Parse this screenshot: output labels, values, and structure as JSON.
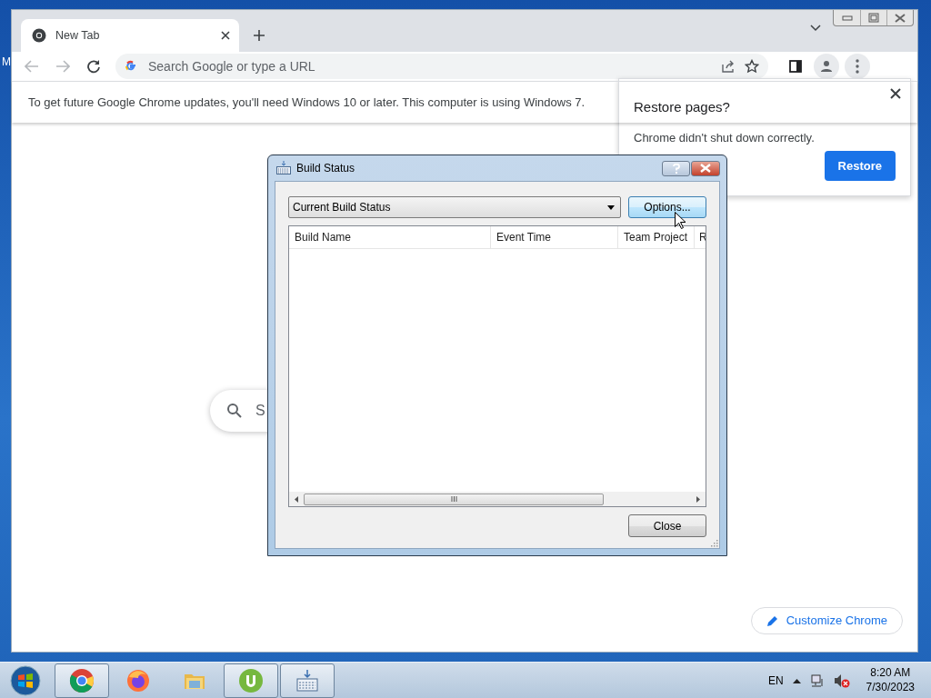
{
  "desktop": {
    "edge_label": "M"
  },
  "browser": {
    "tabs": [
      {
        "title": "New Tab",
        "selected": true
      }
    ],
    "omnibox": {
      "placeholder": "Search Google or type a URL"
    },
    "infobar": "To get future Google Chrome updates, you'll need Windows 10 or later. This computer is using Windows 7.",
    "ntp_search": {
      "placeholder": "S"
    },
    "customize_button": "Customize Chrome"
  },
  "restore_bubble": {
    "title": "Restore pages?",
    "message": "Chrome didn't shut down correctly.",
    "button": "Restore"
  },
  "dialog": {
    "title": "Build Status",
    "view_select": {
      "value": "Current Build Status"
    },
    "options_button": "Options...",
    "columns": [
      "Build Name",
      "Event Time",
      "Team Project",
      "R"
    ],
    "close_button": "Close"
  },
  "taskbar": {
    "apps": [
      {
        "kind": "chrome",
        "running": true
      },
      {
        "kind": "firefox",
        "running": false
      },
      {
        "kind": "explorer",
        "running": false
      },
      {
        "kind": "utorrent",
        "running": true
      },
      {
        "kind": "build",
        "running": true
      }
    ],
    "language": "EN",
    "time": "8:20 AM",
    "date": "7/30/2023"
  }
}
